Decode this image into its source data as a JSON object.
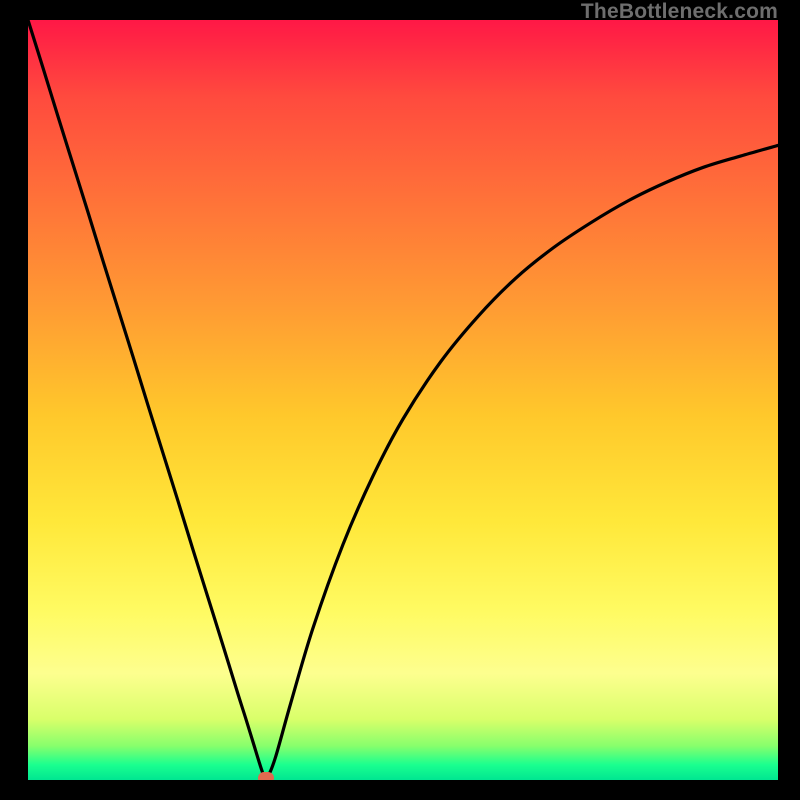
{
  "credit": "TheBottleneck.com",
  "colors": {
    "top_red": "#ff1846",
    "mid_red": "#ff4a3e",
    "orange": "#ff9c33",
    "amber": "#ffc82b",
    "yellow1": "#ffe83a",
    "yellow2": "#fffb63",
    "yellow3": "#fdff8f",
    "yellowgreen": "#d9ff6a",
    "green1": "#88ff6c",
    "green2": "#1aff8f",
    "green3": "#00e691",
    "marker": "#e06a50",
    "curve": "#000000"
  },
  "chart_data": {
    "type": "line",
    "title": "",
    "xlabel": "",
    "ylabel": "",
    "xlim": [
      0,
      100
    ],
    "ylim": [
      0,
      100
    ],
    "series": [
      {
        "name": "bottleneck-curve",
        "x": [
          0,
          2,
          4,
          6,
          8,
          10,
          12,
          14,
          16,
          18,
          20,
          22,
          24,
          26,
          28,
          29,
          30,
          31,
          31.5,
          32,
          33,
          35,
          38,
          42,
          46,
          50,
          55,
          60,
          65,
          70,
          75,
          80,
          85,
          90,
          95,
          100
        ],
        "values": [
          100,
          93.7,
          87.3,
          81,
          74.7,
          68.3,
          62,
          55.7,
          49.3,
          43,
          36.7,
          30.3,
          24,
          17.7,
          11.3,
          8.2,
          5,
          1.8,
          0.5,
          0.5,
          3,
          10,
          20,
          31,
          40,
          47.5,
          55,
          61,
          66,
          70,
          73.3,
          76.2,
          78.6,
          80.6,
          82.1,
          83.5
        ]
      }
    ],
    "marker": {
      "x": 31.7,
      "y": 0.3
    },
    "gradient_stops": [
      {
        "offset": 0.0,
        "key": "top_red"
      },
      {
        "offset": 0.1,
        "key": "mid_red"
      },
      {
        "offset": 0.38,
        "key": "orange"
      },
      {
        "offset": 0.52,
        "key": "amber"
      },
      {
        "offset": 0.66,
        "key": "yellow1"
      },
      {
        "offset": 0.78,
        "key": "yellow2"
      },
      {
        "offset": 0.86,
        "key": "yellow3"
      },
      {
        "offset": 0.92,
        "key": "yellowgreen"
      },
      {
        "offset": 0.955,
        "key": "green1"
      },
      {
        "offset": 0.98,
        "key": "green2"
      },
      {
        "offset": 1.0,
        "key": "green3"
      }
    ]
  }
}
